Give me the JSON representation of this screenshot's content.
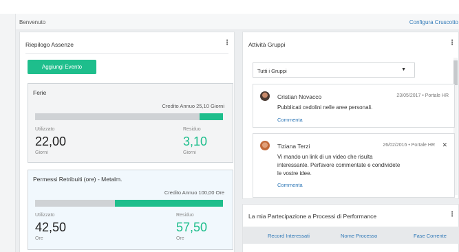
{
  "header": {
    "welcome": "Benvenuto",
    "config_link": "Configura Cruscotto"
  },
  "absences": {
    "title": "Riepilogo Assenze",
    "add_button": "Aggiungi Evento",
    "ferie": {
      "title": "Ferie",
      "credit": "Credito Annuo 25,10 Giorni",
      "residual_fraction": 0.124,
      "used_label": "Utilizzato",
      "used_value": "22,00",
      "used_unit": "Giorni",
      "residual_label": "Residuo",
      "residual_value": "3,10",
      "residual_unit": "Giorni"
    },
    "permessi": {
      "title": "Permessi Retribuiti (ore) - Metalm.",
      "credit": "Credito Annuo 100,00 Ore",
      "residual_fraction": 0.575,
      "used_label": "Utilizzato",
      "used_value": "42,50",
      "used_unit": "Ore",
      "residual_label": "Residuo",
      "residual_value": "57,50",
      "residual_unit": "Ore"
    }
  },
  "groups": {
    "title": "Attività Gruppi",
    "filter": "Tutti i Gruppi",
    "posts": [
      {
        "author": "Cristian Novacco",
        "meta": "23/05/2017 • Portale HR",
        "lines": [
          "Pubblicati cedolini nelle aree personali."
        ],
        "comment": "Commenta"
      },
      {
        "author": "Tiziana Terzi",
        "meta": "26/02/2016 • Portale HR",
        "lines": [
          "Vi mando un link di un video che risulta",
          "interessante. Perfavore commentate e condividete",
          "le vostre idee."
        ],
        "comment": "Commenta"
      }
    ]
  },
  "performance": {
    "title": "La mia Partecipazione a Processi di Performance",
    "columns": [
      "Record Interessati",
      "Nome Processo",
      "Fase Corrente"
    ]
  },
  "colors": {
    "accent": "#1ebe8c",
    "link": "#2f78b7",
    "track": "#cfd2d5"
  },
  "icons": {
    "menu": "kebab-menu-icon",
    "close": "close-icon",
    "dropdown": "caret-down-icon"
  }
}
